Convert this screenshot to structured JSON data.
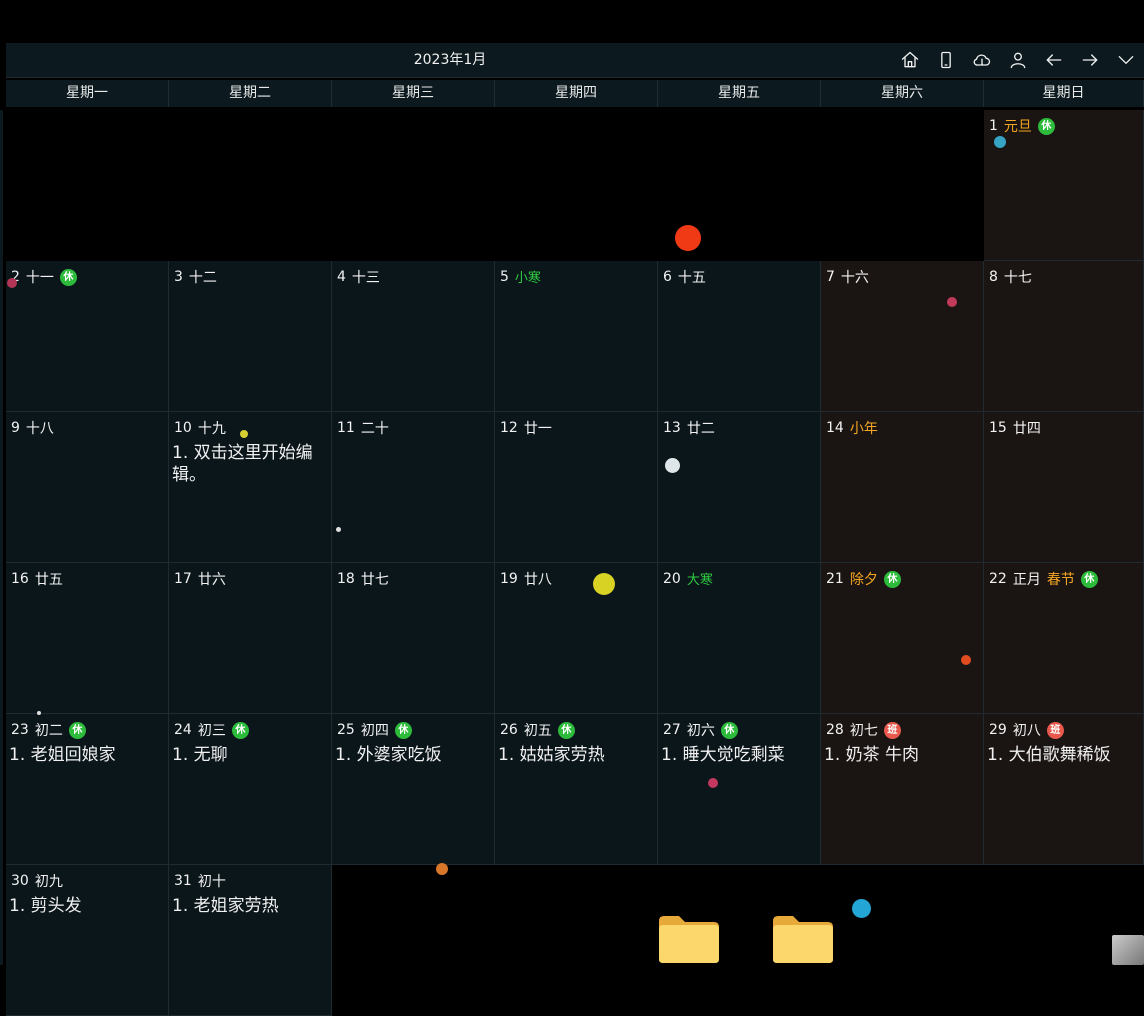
{
  "title": "2023年1月",
  "toolbar": [
    {
      "name": "home-icon",
      "icon": "home"
    },
    {
      "name": "phone-icon",
      "icon": "phone"
    },
    {
      "name": "cloud-icon",
      "icon": "cloud"
    },
    {
      "name": "user-icon",
      "icon": "user"
    },
    {
      "name": "arrow-left-icon",
      "icon": "left"
    },
    {
      "name": "arrow-right-icon",
      "icon": "right"
    },
    {
      "name": "chevron-down-icon",
      "icon": "down"
    }
  ],
  "weekdays": [
    "星期一",
    "星期二",
    "星期三",
    "星期四",
    "星期五",
    "星期六",
    "星期日"
  ],
  "colors": {
    "rest_badge": "#2dbb3c",
    "work_badge": "#e8584d",
    "solar_term": "#2ecc40",
    "festival": "#f5a623"
  },
  "badges": {
    "rest": "休",
    "work": "班"
  },
  "days": [
    {
      "day": "1",
      "col": 6,
      "row": 0,
      "lunar": "元旦",
      "lunar_style": "fest",
      "badge": "rest"
    },
    {
      "day": "2",
      "col": 0,
      "row": 1,
      "lunar": "十一",
      "badge": "rest"
    },
    {
      "day": "3",
      "col": 1,
      "row": 1,
      "lunar": "十二"
    },
    {
      "day": "4",
      "col": 2,
      "row": 1,
      "lunar": "十三"
    },
    {
      "day": "5",
      "col": 3,
      "row": 1,
      "lunar": "小寒",
      "lunar_style": "term"
    },
    {
      "day": "6",
      "col": 4,
      "row": 1,
      "lunar": "十五"
    },
    {
      "day": "7",
      "col": 5,
      "row": 1,
      "lunar": "十六"
    },
    {
      "day": "8",
      "col": 6,
      "row": 1,
      "lunar": "十七"
    },
    {
      "day": "9",
      "col": 0,
      "row": 2,
      "lunar": "十八"
    },
    {
      "day": "10",
      "col": 1,
      "row": 2,
      "lunar": "十九",
      "note": "1. 双击这里开始编辑。"
    },
    {
      "day": "11",
      "col": 2,
      "row": 2,
      "lunar": "二十"
    },
    {
      "day": "12",
      "col": 3,
      "row": 2,
      "lunar": "廿一"
    },
    {
      "day": "13",
      "col": 4,
      "row": 2,
      "lunar": "廿二"
    },
    {
      "day": "14",
      "col": 5,
      "row": 2,
      "lunar": "小年",
      "lunar_style": "fest"
    },
    {
      "day": "15",
      "col": 6,
      "row": 2,
      "lunar": "廿四"
    },
    {
      "day": "16",
      "col": 0,
      "row": 3,
      "lunar": "廿五"
    },
    {
      "day": "17",
      "col": 1,
      "row": 3,
      "lunar": "廿六"
    },
    {
      "day": "18",
      "col": 2,
      "row": 3,
      "lunar": "廿七"
    },
    {
      "day": "19",
      "col": 3,
      "row": 3,
      "lunar": "廿八"
    },
    {
      "day": "20",
      "col": 4,
      "row": 3,
      "lunar": "大寒",
      "lunar_style": "term"
    },
    {
      "day": "21",
      "col": 5,
      "row": 3,
      "lunar": "除夕",
      "lunar_style": "fest",
      "badge": "rest"
    },
    {
      "day": "22",
      "col": 6,
      "row": 3,
      "lunar": "正月",
      "extra": "春节",
      "badge": "rest"
    },
    {
      "day": "23",
      "col": 0,
      "row": 4,
      "lunar": "初二",
      "badge": "rest",
      "note": "1. 老姐回娘家"
    },
    {
      "day": "24",
      "col": 1,
      "row": 4,
      "lunar": "初三",
      "badge": "rest",
      "note": "1. 无聊"
    },
    {
      "day": "25",
      "col": 2,
      "row": 4,
      "lunar": "初四",
      "badge": "rest",
      "note": "1. 外婆家吃饭"
    },
    {
      "day": "26",
      "col": 3,
      "row": 4,
      "lunar": "初五",
      "badge": "rest",
      "note": "1. 姑姑家劳热"
    },
    {
      "day": "27",
      "col": 4,
      "row": 4,
      "lunar": "初六",
      "badge": "rest",
      "note": "1. 睡大觉吃剩菜"
    },
    {
      "day": "28",
      "col": 5,
      "row": 4,
      "lunar": "初七",
      "badge": "work",
      "note": "1. 奶茶 牛肉"
    },
    {
      "day": "29",
      "col": 6,
      "row": 4,
      "lunar": "初八",
      "badge": "work",
      "note": "1. 大伯歌舞稀饭"
    },
    {
      "day": "30",
      "col": 0,
      "row": 5,
      "lunar": "初九",
      "note": "1. 剪头发"
    },
    {
      "day": "31",
      "col": 1,
      "row": 5,
      "lunar": "初十",
      "note": "1. 老姐家劳热"
    }
  ]
}
